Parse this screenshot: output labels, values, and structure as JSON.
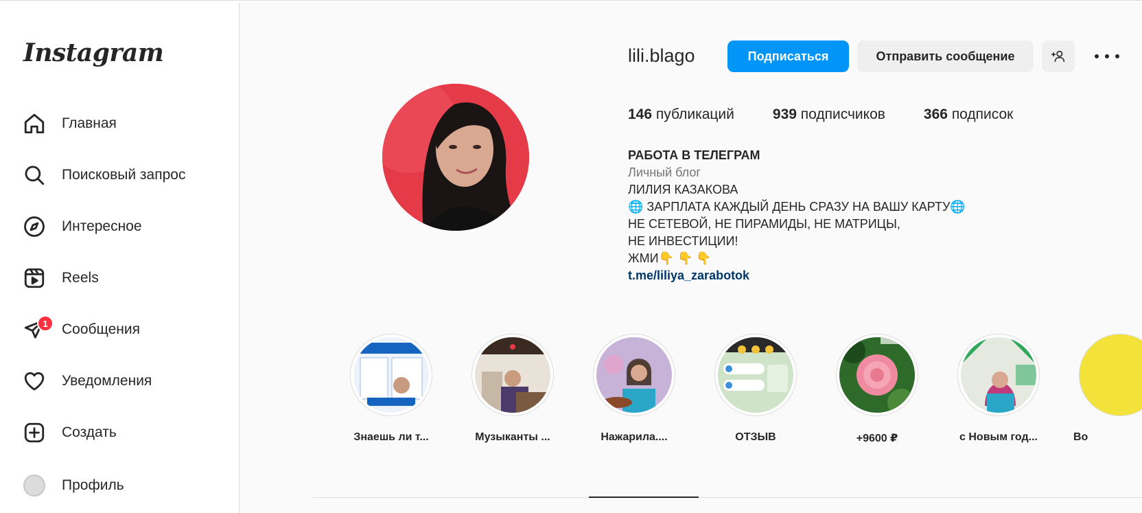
{
  "app": {
    "logo_text": "Instagram"
  },
  "sidebar": {
    "items": [
      {
        "label": "Главная",
        "icon": "home-icon"
      },
      {
        "label": "Поисковый запрос",
        "icon": "search-icon"
      },
      {
        "label": "Интересное",
        "icon": "compass-icon"
      },
      {
        "label": "Reels",
        "icon": "reels-icon"
      },
      {
        "label": "Сообщения",
        "icon": "messenger-icon",
        "badge": "1"
      },
      {
        "label": "Уведомления",
        "icon": "heart-icon"
      },
      {
        "label": "Создать",
        "icon": "create-icon"
      },
      {
        "label": "Профиль",
        "icon": "avatar"
      }
    ]
  },
  "profile": {
    "username": "lili.blago",
    "follow_label": "Подписаться",
    "message_label": "Отправить сообщение",
    "suggest_icon": "add-person-icon",
    "more_icon": "more-icon",
    "stats": {
      "posts_count": "146",
      "posts_label": "публикаций",
      "followers_count": "939",
      "followers_label": "подписчиков",
      "following_count": "366",
      "following_label": "подписок"
    },
    "bio": {
      "name": "РАБОТА В ТЕЛЕГРАМ",
      "category": "Личный блог",
      "line1": "ЛИЛИЯ КАЗАКОВА",
      "line2": "🌐 ЗАРПЛАТА КАЖДЫЙ ДЕНЬ СРАЗУ НА ВАШУ КАРТУ🌐",
      "line3": "НЕ СЕТЕВОЙ, НЕ ПИРАМИДЫ, НЕ МАТРИЦЫ,",
      "line4": "НЕ ИНВЕСТИЦИИ!",
      "line5": "ЖМИ👇 👇 👇",
      "link": "t.me/liliya_zarabotok"
    }
  },
  "highlights": [
    {
      "label": "Знаешь ли т...",
      "colors": [
        "#e8f0fb",
        "#1565c0"
      ]
    },
    {
      "label": "Музыканты ...",
      "colors": [
        "#d8c9b8",
        "#6b4f3a"
      ]
    },
    {
      "label": "Нажарила....",
      "colors": [
        "#c7b2d8",
        "#2aa6c9"
      ]
    },
    {
      "label": "ОТЗЫВ",
      "colors": [
        "#cfe3c8",
        "#3b8f4a"
      ]
    },
    {
      "label": "+9600 ₽",
      "colors": [
        "#2e6b2a",
        "#f08aa0"
      ]
    },
    {
      "label": "с Новым год...",
      "colors": [
        "#2fa85c",
        "#e0c9d2"
      ]
    },
    {
      "label": "Во",
      "colors": [
        "#f3e23a",
        "#ffffff"
      ]
    }
  ],
  "colors": {
    "primary_button": "#0095f6",
    "badge": "#ff3040",
    "link": "#00376b"
  }
}
